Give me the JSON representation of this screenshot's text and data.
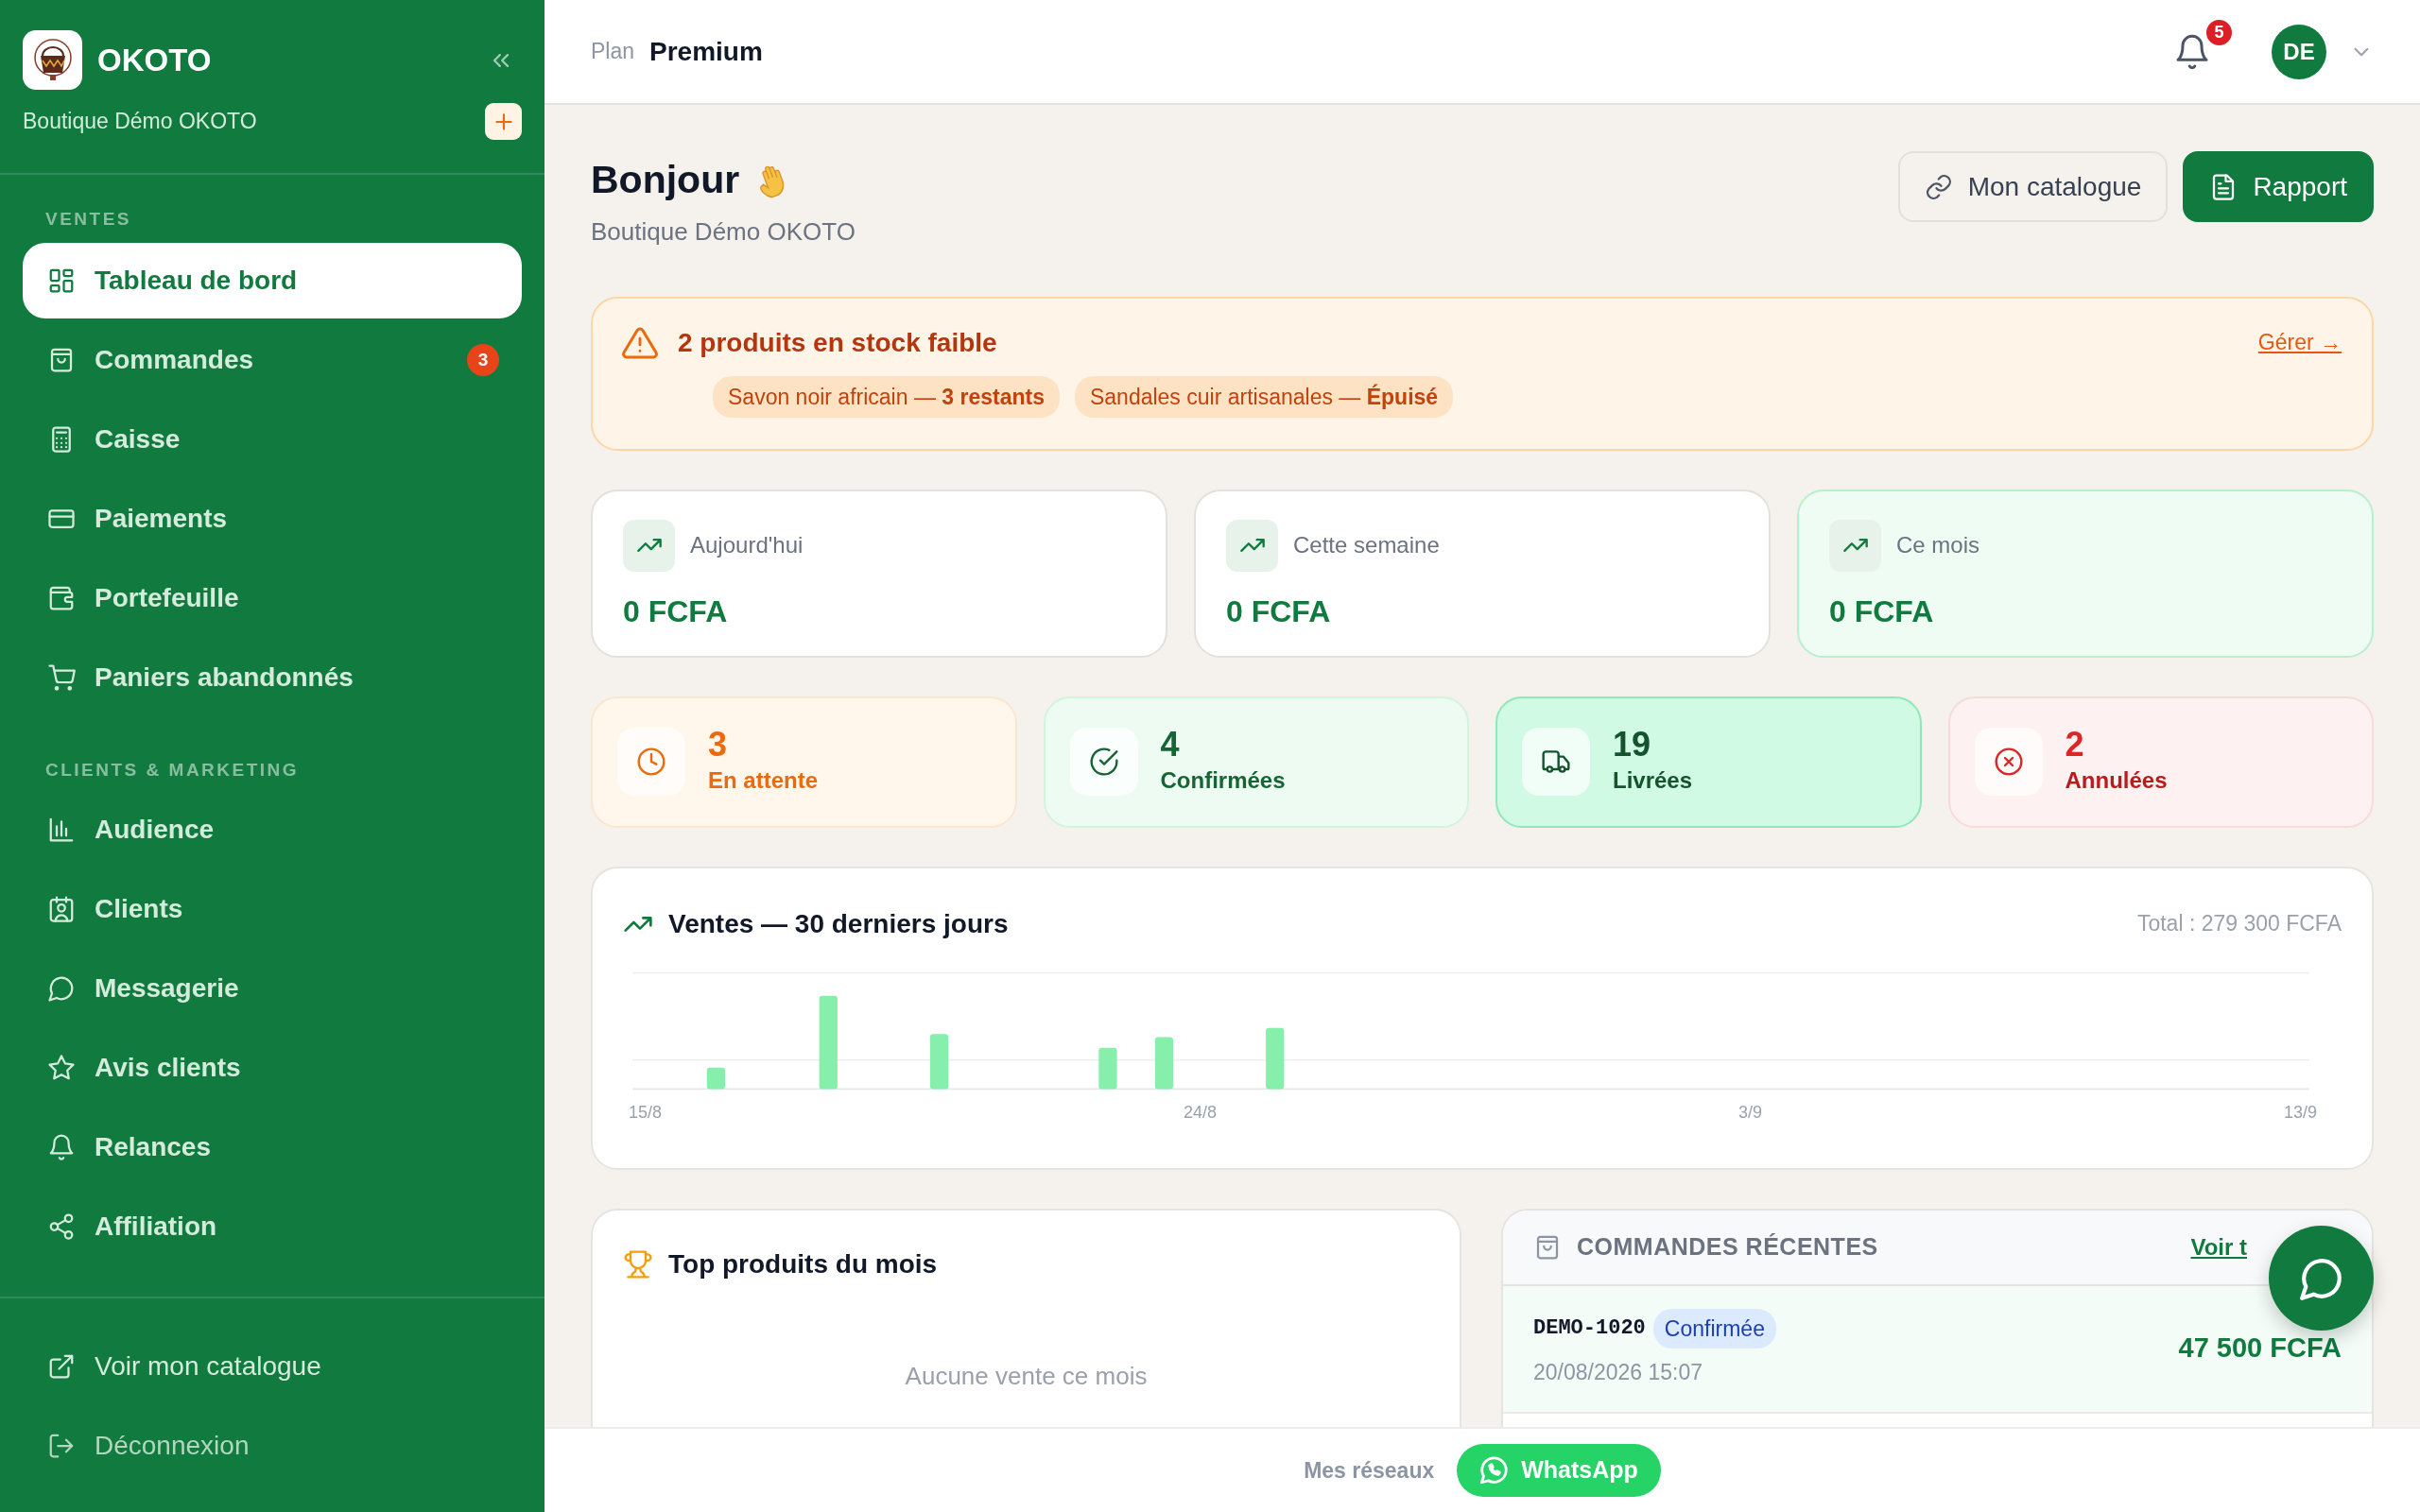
{
  "sidebar": {
    "brand": "OKOTO",
    "shop": "Boutique Démo OKOTO",
    "sections": [
      {
        "label": "VENTES",
        "items": [
          {
            "label": "Tableau de bord",
            "selected": true
          },
          {
            "label": "Commandes",
            "selected": false,
            "badge": "3"
          },
          {
            "label": "Caisse",
            "selected": false
          },
          {
            "label": "Paiements",
            "selected": false
          },
          {
            "label": "Portefeuille",
            "selected": false
          },
          {
            "label": "Paniers abandonnés",
            "selected": false
          }
        ]
      },
      {
        "label": "CLIENTS & MARKETING",
        "items": [
          {
            "label": "Audience",
            "selected": false
          },
          {
            "label": "Clients",
            "selected": false
          },
          {
            "label": "Messagerie",
            "selected": false
          },
          {
            "label": "Avis clients",
            "selected": false
          },
          {
            "label": "Relances",
            "selected": false
          },
          {
            "label": "Affiliation",
            "selected": false
          }
        ]
      }
    ],
    "footer_links": [
      {
        "label": "Voir mon catalogue",
        "kind": "external"
      },
      {
        "label": "Déconnexion",
        "kind": "logout"
      }
    ]
  },
  "header": {
    "plan_label": "Plan",
    "plan": "Premium",
    "notifications": "5",
    "avatar": "DE"
  },
  "greeting": {
    "title": "Bonjour",
    "subtitle": "Boutique Démo OKOTO",
    "buttons": [
      {
        "label": "Mon catalogue",
        "kind": "outline"
      },
      {
        "label": "Rapport",
        "kind": "primary"
      }
    ]
  },
  "alert": {
    "title": "2 produits en stock faible",
    "link": "Gérer →",
    "chips": [
      "Savon noir africain — **3 restants**",
      "Sandales cuir artisanales — **Épuisé**"
    ]
  },
  "revenue": [
    {
      "label": "Aujourd'hui",
      "value": "0 FCFA",
      "highlighted": false
    },
    {
      "label": "Cette semaine",
      "value": "0 FCFA",
      "highlighted": false
    },
    {
      "label": "Ce mois",
      "value": "0 FCFA",
      "highlighted": true
    }
  ],
  "order_stats": [
    {
      "count": "3",
      "label": "En attente",
      "kind": "pending"
    },
    {
      "count": "4",
      "label": "Confirmées",
      "kind": "confirmed"
    },
    {
      "count": "19",
      "label": "Livrées",
      "kind": "delivered"
    },
    {
      "count": "2",
      "label": "Annulées",
      "kind": "cancelled"
    }
  ],
  "sales_chart": {
    "title": "Ventes — 30 derniers jours",
    "total": "Total : 279 300 FCFA",
    "axis_labels": [
      "15/8",
      "24/8",
      "3/9",
      "13/9"
    ]
  },
  "top_products": {
    "title": "Top produits du mois",
    "empty": "Aucune vente ce mois"
  },
  "recent_orders": {
    "title": "COMMANDES RÉCENTES",
    "link": "Voir t",
    "orders": [
      {
        "id": "DEMO-1020",
        "status": "Confirmée",
        "kind": "confirmed",
        "date": "20/08/2026 15:07",
        "amount": "47 500 FCFA"
      }
    ]
  },
  "footer": {
    "label": "Mes réseaux",
    "button": "WhatsApp"
  }
}
